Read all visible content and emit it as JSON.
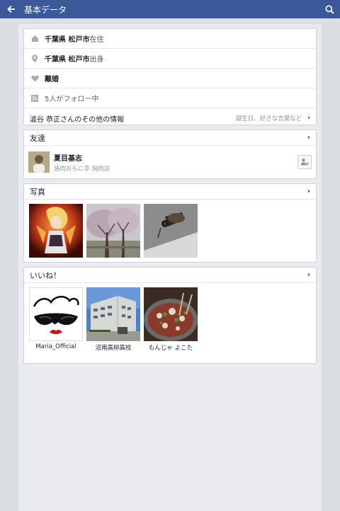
{
  "topbar": {
    "title": "基本データ"
  },
  "info": {
    "location_name": "千葉県 松戸市",
    "location_suffix": "在住",
    "hometown_name": "千葉県 松戸市",
    "hometown_suffix": "出身",
    "relationship": "離婚",
    "followers": "5人がフォロー中",
    "more_left": "澁谷 恭正さんのその他の情報",
    "more_right": "誕生日、好きな言葉など"
  },
  "friends": {
    "header": "友達",
    "items": [
      {
        "name": "夏目基志",
        "sub": "焼肉おもに亭 焼肉店"
      }
    ]
  },
  "photos": {
    "header": "写真"
  },
  "likes": {
    "header": "いいね！",
    "items": [
      {
        "label": "Maria_Official"
      },
      {
        "label": "沼南高柳高校"
      },
      {
        "label": "もんじゃ よこた"
      }
    ]
  },
  "colors": {
    "topbar": "#3b5998",
    "page_bg": "#dadde1",
    "card_bg": "#ffffff",
    "link": "#4b6a9b"
  },
  "icons": [
    "back-arrow-icon",
    "search-icon",
    "home-icon",
    "location-pin-icon",
    "heart-icon",
    "rss-icon",
    "add-friend-icon",
    "chevron-right-icon"
  ]
}
